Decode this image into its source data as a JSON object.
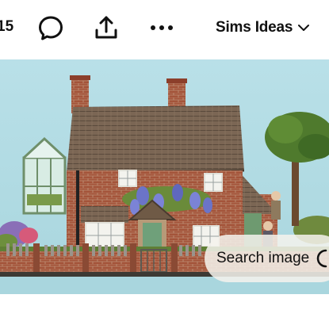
{
  "header": {
    "count_fragment": "15",
    "board_name": "Sims Ideas",
    "icons": {
      "comment": "comment-bubble-icon",
      "share": "share-upload-icon",
      "more": "more-dots-icon",
      "dropdown": "chevron-down-icon"
    }
  },
  "image": {
    "subject": "miniature model of a brick cottage with tiled roof, greenhouse, wisteria and picket fence"
  },
  "overlay": {
    "search_image_label": "Search image",
    "lens_icon": "visual-search-icon"
  },
  "colors": {
    "text": "#111111",
    "sky": "#b8dfe6",
    "brick": "#a55238",
    "roof": "#7d6a55"
  }
}
